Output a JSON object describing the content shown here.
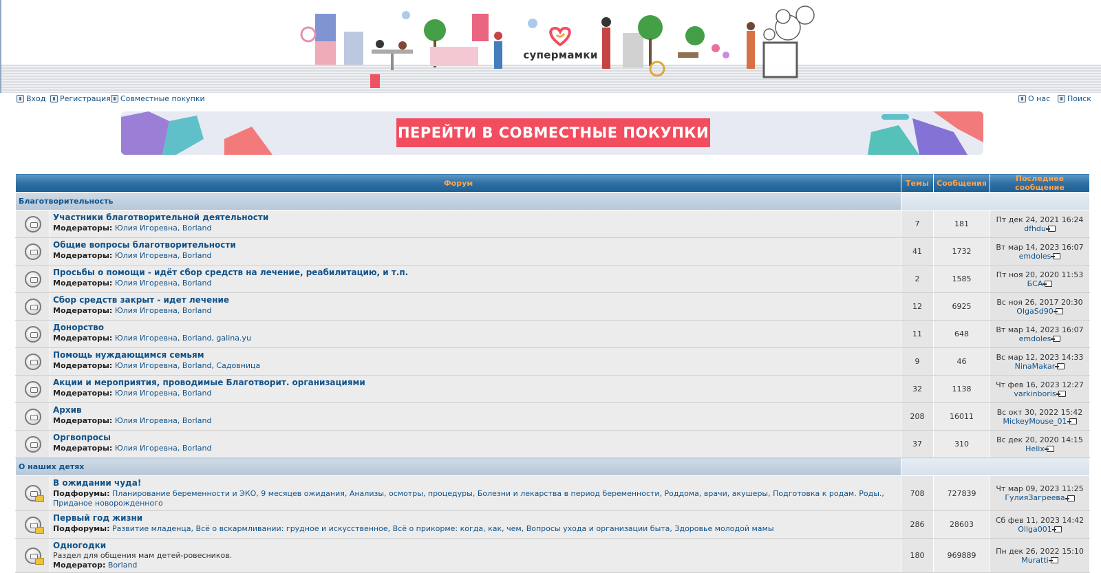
{
  "header": {
    "logo_text": "супермамки",
    "brand_color": "#f14d5e"
  },
  "nav": {
    "left": [
      {
        "label": "Вход",
        "icon": "login-icon"
      },
      {
        "label": "Регистрация",
        "icon": "register-icon"
      },
      {
        "label": "Совместные покупки",
        "icon": "dollar-icon"
      }
    ],
    "right": [
      {
        "label": "О нас",
        "icon": "info-icon"
      },
      {
        "label": "Поиск",
        "icon": "search-icon"
      }
    ]
  },
  "promo": {
    "button_label": "ПЕРЕЙТИ В СОВМЕСТНЫЕ ПОКУПКИ"
  },
  "table": {
    "headers": {
      "forum": "Форум",
      "topics": "Темы",
      "posts": "Сообщения",
      "last_post": "Последнее сообщение"
    },
    "moderators_label": "Модераторы:",
    "moderator_label": "Модератор:",
    "subforums_label": "Подфорумы:"
  },
  "categories": [
    {
      "name": "Благотворительность",
      "forums": [
        {
          "title": "Участники благотворительной деятельности",
          "mods": "Юлия Игоревна, Borland",
          "topics": "7",
          "posts": "181",
          "last_date": "Пт дек 24, 2021 16:24",
          "last_user": "dfhdu"
        },
        {
          "title": "Общие вопросы благотворительности",
          "mods": "Юлия Игоревна, Borland",
          "topics": "41",
          "posts": "1732",
          "last_date": "Вт мар 14, 2023 16:07",
          "last_user": "emdoles"
        },
        {
          "title": "Просьбы о помощи - идёт сбор средств на лечение, реабилитацию, и т.п.",
          "mods": "Юлия Игоревна, Borland",
          "topics": "2",
          "posts": "1585",
          "last_date": "Пт ноя 20, 2020 11:53",
          "last_user": "БСА"
        },
        {
          "title": "Сбор средств закрыт - идет лечение",
          "mods": "Юлия Игоревна, Borland",
          "topics": "12",
          "posts": "6925",
          "last_date": "Вс ноя 26, 2017 20:30",
          "last_user": "OlgaSd90"
        },
        {
          "title": "Донорство",
          "mods": "Юлия Игоревна, Borland, galina.yu",
          "topics": "11",
          "posts": "648",
          "last_date": "Вт мар 14, 2023 16:07",
          "last_user": "emdoles"
        },
        {
          "title": "Помощь нуждающимся семьям",
          "mods": "Юлия Игоревна, Borland, Садовница",
          "topics": "9",
          "posts": "46",
          "last_date": "Вс мар 12, 2023 14:33",
          "last_user": "NinaMakar"
        },
        {
          "title": "Акции и мероприятия, проводимые Благотворит. организациями",
          "mods": "Юлия Игоревна, Borland",
          "topics": "32",
          "posts": "1138",
          "last_date": "Чт фев 16, 2023 12:27",
          "last_user": "varkinboris"
        },
        {
          "title": "Архив",
          "mods": "Юлия Игоревна, Borland",
          "topics": "208",
          "posts": "16011",
          "last_date": "Вс окт 30, 2022 15:42",
          "last_user": "MickeyMouse_01"
        },
        {
          "title": "Оргвопросы",
          "mods": "Юлия Игоревна, Borland",
          "topics": "37",
          "posts": "310",
          "last_date": "Вс дек 20, 2020 14:15",
          "last_user": "Helix"
        }
      ]
    },
    {
      "name": "О наших детях",
      "forums": [
        {
          "title": "В ожидании чуда!",
          "subforums": "Планирование беременности и ЭКО, 9 месяцев ожидания, Анализы, осмотры, процедуры, Болезни и лекарства в период беременности, Роддома, врачи, акушеры, Подготовка к родам. Роды., Приданое новорожденного",
          "topics": "708",
          "posts": "727839",
          "last_date": "Чт мар 09, 2023 11:25",
          "last_user": "ГулияЗагреева"
        },
        {
          "title": "Первый год жизни",
          "subforums": "Развитие младенца, Всё о вскармливании: грудное и искусственное, Всё о прикорме: когда, как, чем, Вопросы ухода и организации быта, Здоровье молодой мамы",
          "topics": "286",
          "posts": "28603",
          "last_date": "Сб фев 11, 2023 14:42",
          "last_user": "Ollga001"
        },
        {
          "title": "Одногодки",
          "desc": "Раздел для общения мам детей-ровесников.",
          "mods_single": "Borland",
          "topics": "180",
          "posts": "969889",
          "last_date": "Пн дек 26, 2022 15:10",
          "last_user": "Muratti"
        }
      ]
    }
  ]
}
